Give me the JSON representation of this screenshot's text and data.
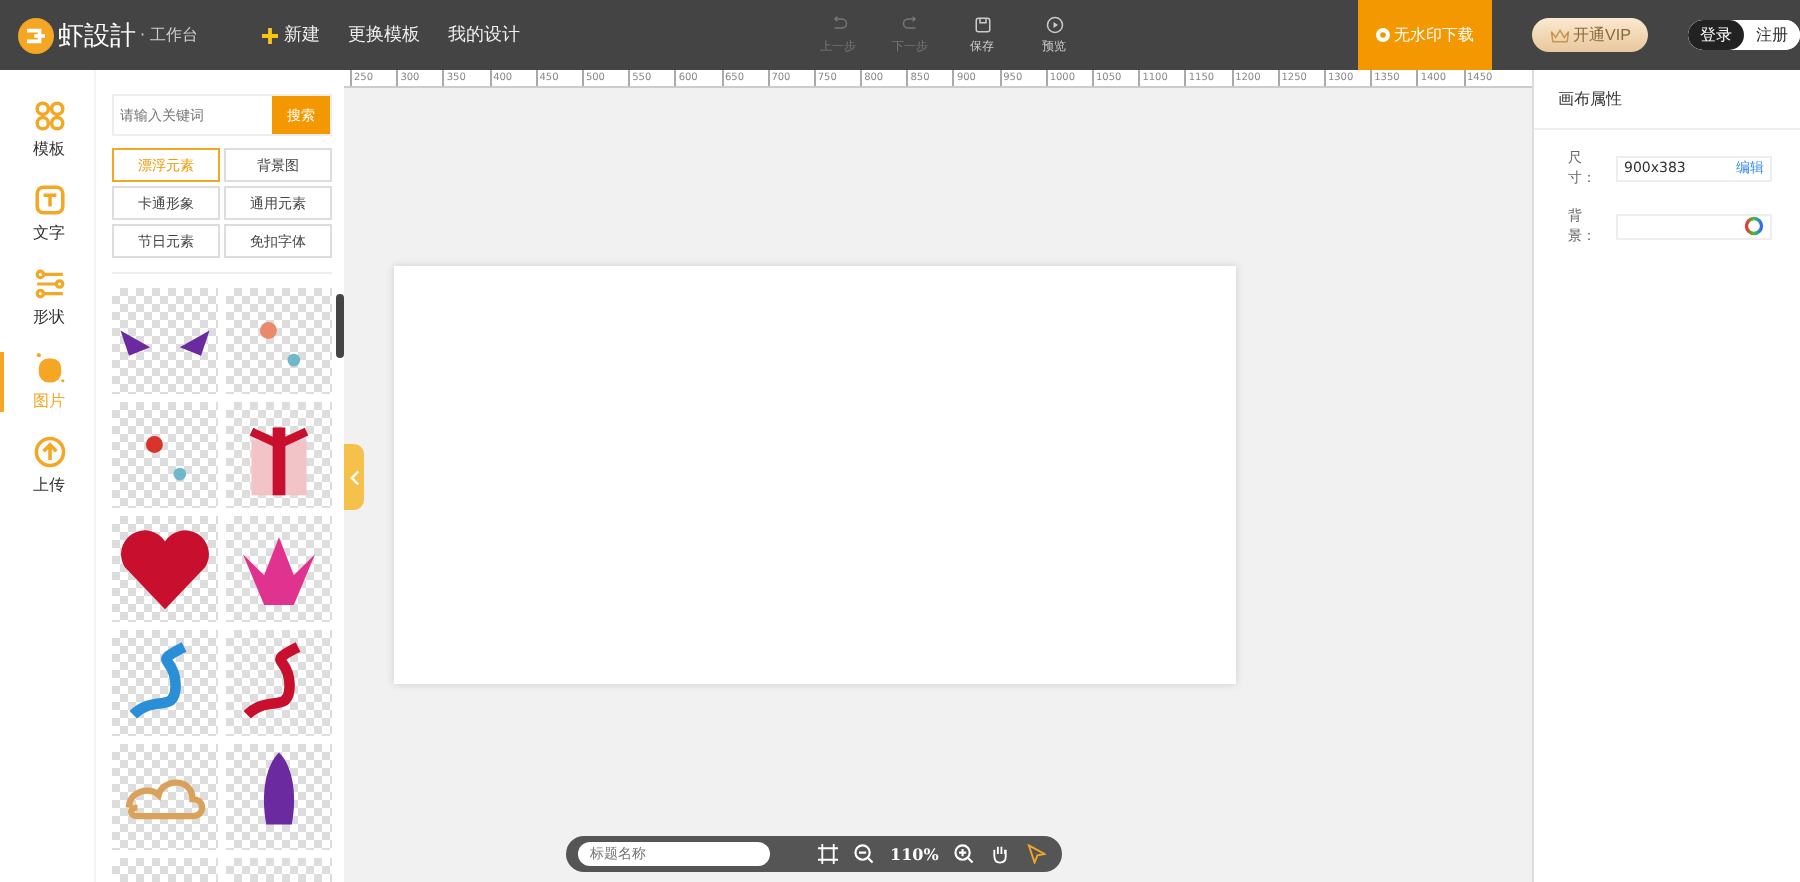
{
  "header": {
    "logo": "虾設計",
    "subtitle": "· 工作台",
    "nav": [
      {
        "label": "新建",
        "kind": "plus"
      },
      {
        "label": "更换模板",
        "kind": "plain"
      },
      {
        "label": "我的设计",
        "kind": "plain"
      }
    ],
    "tools": [
      {
        "label": "上一步",
        "kind": "undo",
        "disabled": true
      },
      {
        "label": "下一步",
        "kind": "redo",
        "disabled": true
      },
      {
        "label": "保存",
        "kind": "save",
        "disabled": false
      },
      {
        "label": "预览",
        "kind": "preview",
        "disabled": false
      }
    ],
    "download": "无水印下载",
    "vip": "开通VIP",
    "auth": [
      {
        "label": "登录",
        "selected": true
      },
      {
        "label": "注册",
        "selected": false
      }
    ]
  },
  "sidebar": {
    "items": [
      {
        "label": "模板",
        "kind": "template",
        "selected": false
      },
      {
        "label": "文字",
        "kind": "text",
        "selected": false
      },
      {
        "label": "形状",
        "kind": "shape",
        "selected": false
      },
      {
        "label": "图片",
        "kind": "image",
        "selected": true
      },
      {
        "label": "上传",
        "kind": "upload",
        "selected": false
      }
    ]
  },
  "panel": {
    "search": {
      "placeholder": "请输入关键词",
      "button": "搜索"
    },
    "categories": [
      {
        "label": "漂浮元素",
        "selected": true
      },
      {
        "label": "背景图",
        "selected": false
      },
      {
        "label": "卡通形象",
        "selected": false
      },
      {
        "label": "通用元素",
        "selected": false
      },
      {
        "label": "节日元素",
        "selected": false
      },
      {
        "label": "免扣字体",
        "selected": false
      }
    ]
  },
  "ruler": [
    "250",
    "300",
    "350",
    "400",
    "450",
    "500",
    "550",
    "600",
    "650",
    "700",
    "750",
    "800",
    "850",
    "900",
    "950",
    "1000",
    "1050",
    "1100",
    "1150",
    "1200",
    "1250",
    "1300",
    "1350",
    "1400",
    "1450"
  ],
  "bottom_bar": {
    "title_placeholder": "标题名称",
    "zoom": "110%"
  },
  "properties": {
    "title": "画布属性",
    "size_label": "尺寸：",
    "size_value": "900x383",
    "edit": "编辑",
    "background_label": "背景："
  }
}
